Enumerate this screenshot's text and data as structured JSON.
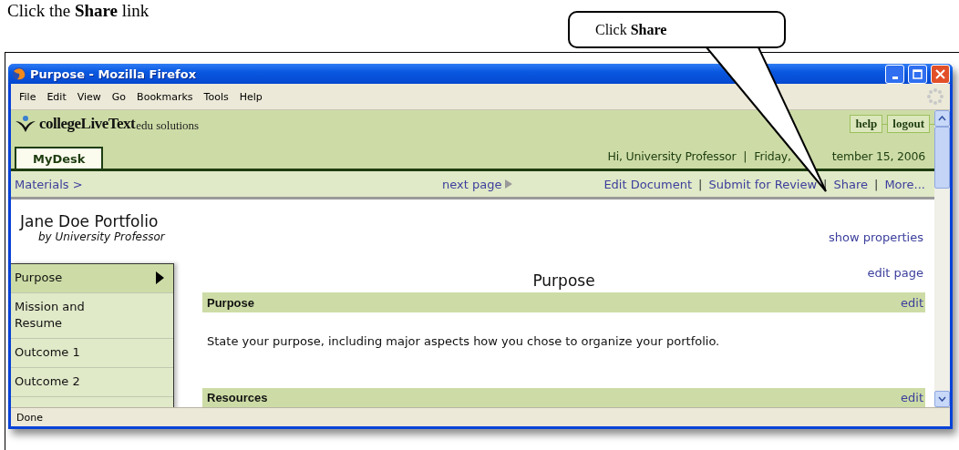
{
  "instruction": "Click the **Share** link",
  "callout": "Click **Share**",
  "window": {
    "title": "Purpose - Mozilla Firefox"
  },
  "menu": [
    "File",
    "Edit",
    "View",
    "Go",
    "Bookmarks",
    "Tools",
    "Help"
  ],
  "site": {
    "logo_main": "collegeLiveText",
    "logo_sub": "edu solutions",
    "buttons": [
      "help",
      "logout"
    ],
    "tab": {
      "label": "MyDesk",
      "selected": true
    },
    "info": [
      {
        "kind": "text",
        "text": "Hi, University Professor"
      },
      {
        "kind": "separator",
        "text": "|"
      },
      {
        "kind": "cut",
        "text": "Friday,"
      },
      {
        "kind": "text",
        "text": "tember 15, 2006"
      }
    ]
  },
  "nav": {
    "breadcrumb": "Materials >",
    "next": "next page",
    "items": [
      {
        "kind": "link",
        "text": "Edit Document"
      },
      {
        "kind": "separator",
        "text": "|"
      },
      {
        "kind": "link",
        "text": "Submit for Review"
      },
      {
        "kind": "separator",
        "text": "|"
      },
      {
        "kind": "link",
        "text": "Share"
      },
      {
        "kind": "separator",
        "text": "|"
      },
      {
        "kind": "link",
        "text": "More..."
      }
    ]
  },
  "document": {
    "title": "Jane Doe Portfolio",
    "author": "by University Professor",
    "show_properties": "show properties",
    "edit_page": "edit page",
    "page_title": "Purpose"
  },
  "sidebar": {
    "items": [
      {
        "label": "Purpose",
        "selected": true
      },
      {
        "label": "Mission and Resume",
        "selected": false
      },
      {
        "label": "Outcome 1",
        "selected": false
      },
      {
        "label": "Outcome 2",
        "selected": false
      }
    ]
  },
  "sections": [
    {
      "title": "Purpose",
      "edit": "edit",
      "body": "State your purpose, including major aspects how you chose to organize your portfolio."
    },
    {
      "title": "Resources",
      "edit": "edit"
    }
  ],
  "status_bar": "Done"
}
